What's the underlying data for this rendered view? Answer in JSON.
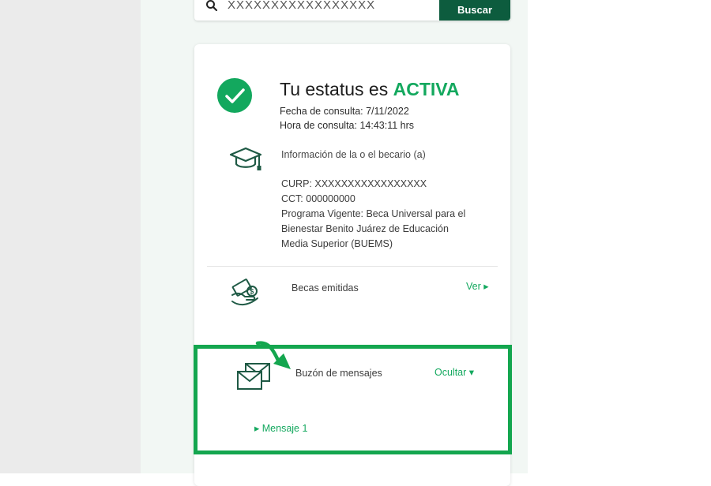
{
  "search": {
    "value": "XXXXXXXXXXXXXXXXX",
    "button_label": "Buscar"
  },
  "status": {
    "prefix": "Tu estatus es ",
    "value": "ACTIVA",
    "fecha_consulta": "Fecha de consulta: 7/11/2022",
    "hora_consulta": "Hora de consulta: 14:43:11 hrs"
  },
  "becario": {
    "heading": "Información de la o el becario (a)",
    "curp": "CURP: XXXXXXXXXXXXXXXXX",
    "cct": "CCT: 000000000",
    "programa_lines": [
      "Programa Vigente: Beca Universal para el",
      "Bienestar Benito Juárez de Educación",
      "Media Superior (BUEMS)"
    ]
  },
  "becas": {
    "label": "Becas emitidas",
    "link": "Ver ▸"
  },
  "buzon": {
    "label": "Buzón de mensajes",
    "toggle": "Ocultar ▾",
    "messages": [
      "▸ Mensaje 1"
    ]
  },
  "colors": {
    "accent_green": "#13a85e",
    "dark_green": "#0d5c3e",
    "highlight_green": "#14a64f"
  },
  "icons": {
    "search": "search-icon",
    "status": "check-circle-icon",
    "becario": "graduation-cap-icon",
    "becas": "money-hand-icon",
    "buzon": "envelope-icon"
  }
}
